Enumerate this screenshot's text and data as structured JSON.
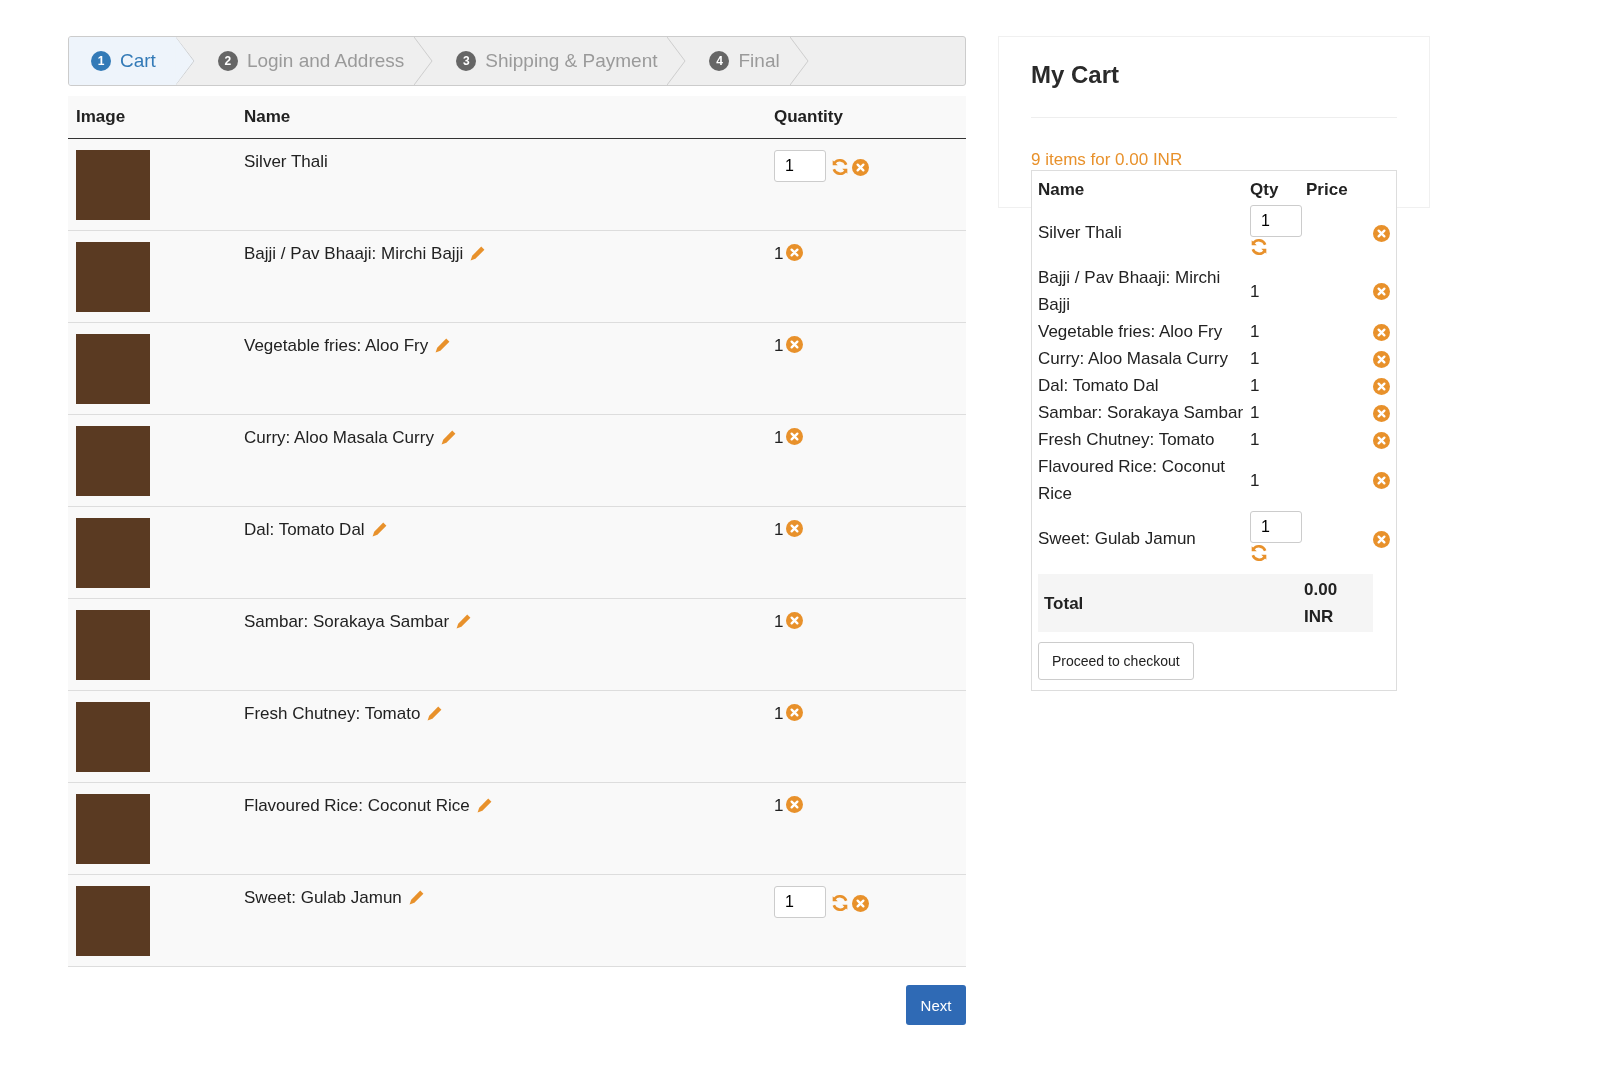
{
  "steps": [
    {
      "number": "1",
      "label": "Cart",
      "selected": true
    },
    {
      "number": "2",
      "label": "Login and Address",
      "selected": false
    },
    {
      "number": "3",
      "label": "Shipping & Payment",
      "selected": false
    },
    {
      "number": "4",
      "label": "Final",
      "selected": false
    }
  ],
  "table": {
    "columns": [
      "Image",
      "Name",
      "Quantity"
    ],
    "rows": [
      {
        "name": "Silver Thali",
        "editable": false,
        "kind": "input",
        "quantity": "1"
      },
      {
        "name": "Bajji / Pav Bhaaji: Mirchi Bajji",
        "editable": true,
        "kind": "plain",
        "quantity": "1"
      },
      {
        "name": "Vegetable fries: Aloo Fry",
        "editable": true,
        "kind": "plain",
        "quantity": "1"
      },
      {
        "name": "Curry: Aloo Masala Curry",
        "editable": true,
        "kind": "plain",
        "quantity": "1"
      },
      {
        "name": "Dal: Tomato Dal",
        "editable": true,
        "kind": "plain",
        "quantity": "1"
      },
      {
        "name": "Sambar: Sorakaya Sambar",
        "editable": true,
        "kind": "plain",
        "quantity": "1"
      },
      {
        "name": "Fresh Chutney: Tomato",
        "editable": true,
        "kind": "plain",
        "quantity": "1"
      },
      {
        "name": "Flavoured Rice: Coconut Rice",
        "editable": true,
        "kind": "plain",
        "quantity": "1"
      },
      {
        "name": "Sweet: Gulab Jamun",
        "editable": true,
        "kind": "input",
        "quantity": "1"
      }
    ]
  },
  "next_button": "Next",
  "cart": {
    "title": "My Cart",
    "summary": "9 items for 0.00 INR",
    "columns": [
      "Name",
      "Qty",
      "Price"
    ],
    "items": [
      {
        "name": "Silver Thali",
        "kind": "input",
        "qty": "1"
      },
      {
        "name": "Bajji / Pav Bhaaji: Mirchi Bajji",
        "kind": "plain",
        "qty": "1"
      },
      {
        "name": "Vegetable fries: Aloo Fry",
        "kind": "plain",
        "qty": "1"
      },
      {
        "name": "Curry: Aloo Masala Curry",
        "kind": "plain",
        "qty": "1"
      },
      {
        "name": "Dal: Tomato Dal",
        "kind": "plain",
        "qty": "1"
      },
      {
        "name": "Sambar: Sorakaya Sambar",
        "kind": "plain",
        "qty": "1"
      },
      {
        "name": "Fresh Chutney: Tomato",
        "kind": "plain",
        "qty": "1"
      },
      {
        "name": "Flavoured Rice: Coconut Rice",
        "kind": "plain",
        "qty": "1"
      },
      {
        "name": "Sweet: Gulab Jamun",
        "kind": "input",
        "qty": "1"
      }
    ],
    "total_label": "Total",
    "total_value": "0.00 INR",
    "checkout_button": "Proceed to checkout"
  }
}
